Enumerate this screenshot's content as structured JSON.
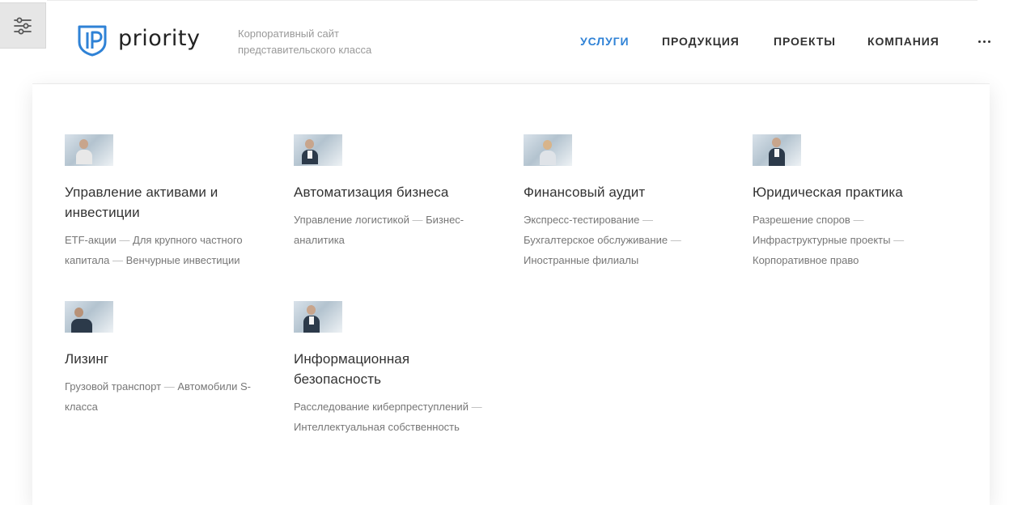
{
  "header": {
    "logo_text": "priority",
    "tagline_line1": "Корпоративный сайт",
    "tagline_line2": "представительского класса",
    "nav": [
      {
        "label": "УСЛУГИ",
        "active": true
      },
      {
        "label": "ПРОДУКЦИЯ",
        "active": false
      },
      {
        "label": "ПРОЕКТЫ",
        "active": false
      },
      {
        "label": "КОМПАНИЯ",
        "active": false
      }
    ],
    "icons": {
      "settings": "sliders-icon",
      "more": "more-horizontal-icon"
    },
    "accent_color": "#2f82d6"
  },
  "dropdown": {
    "separator": "—",
    "items": [
      {
        "title": "Управление активами и инвестиции",
        "links": [
          "ETF-акции",
          "Для крупного частного капитала",
          "Венчурные инвестиции"
        ]
      },
      {
        "title": "Автоматизация бизнеса",
        "links": [
          "Управление логистикой",
          "Бизнес-аналитика"
        ]
      },
      {
        "title": "Финансовый аудит",
        "links": [
          "Экспресс-тестирование",
          "Бухгалтерское обслуживание",
          "Иностранные филиалы"
        ]
      },
      {
        "title": "Юридическая практика",
        "links": [
          "Разрешение споров",
          "Инфраструктурные проекты",
          "Корпоративное право"
        ]
      },
      {
        "title": "Лизинг",
        "links": [
          "Грузовой транспорт",
          "Автомобили S-класса"
        ]
      },
      {
        "title": "Информационная безопасность",
        "links": [
          "Расследование киберпреступлений",
          "Интеллектуальная собственность"
        ]
      }
    ]
  }
}
